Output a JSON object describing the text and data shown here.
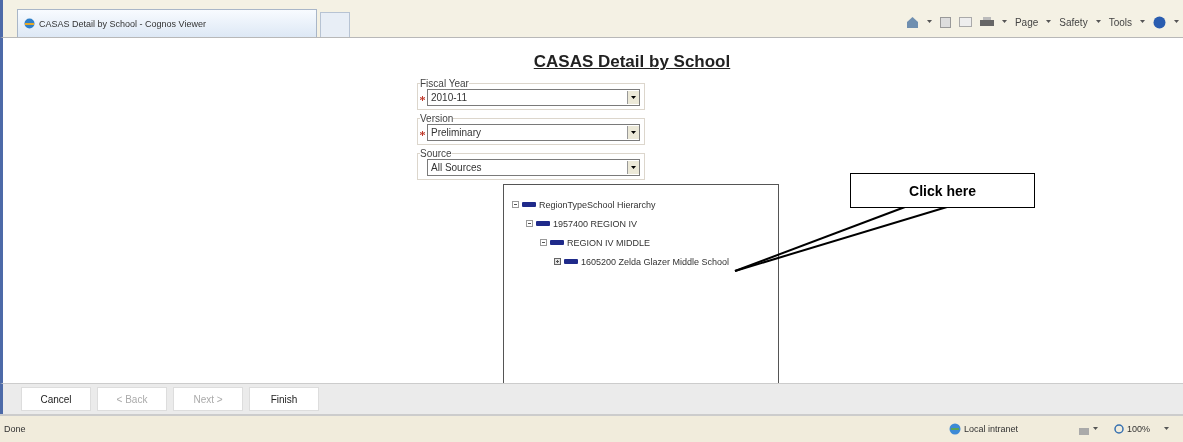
{
  "browser_tab": {
    "title": "CASAS Detail by School - Cognos Viewer"
  },
  "toolbar": {
    "menus": [
      "Page",
      "Safety",
      "Tools"
    ]
  },
  "report": {
    "title": "CASAS Detail by School"
  },
  "parameters": [
    {
      "label": "Fiscal Year",
      "value": "2010-11",
      "required": true
    },
    {
      "label": "Version",
      "value": "Preliminary",
      "required": true
    },
    {
      "label": "Source",
      "value": "All Sources",
      "required": false
    }
  ],
  "tree": [
    {
      "label": "RegionTypeSchool Hierarchy",
      "expanded": true,
      "children": [
        {
          "label": "1957400 REGION IV",
          "expanded": true,
          "children": [
            {
              "label": "REGION IV MIDDLE",
              "expanded": true,
              "children": [
                {
                  "label": "1605200 Zelda Glazer Middle School",
                  "expanded": false
                }
              ]
            }
          ]
        }
      ]
    }
  ],
  "callout": {
    "text": "Click here"
  },
  "buttons": [
    {
      "label": "Cancel",
      "disabled": false
    },
    {
      "label": "< Back",
      "disabled": true
    },
    {
      "label": "Next >",
      "disabled": true
    },
    {
      "label": "Finish",
      "disabled": false
    }
  ],
  "status_bar": {
    "text": "Done",
    "zone": "Local intranet",
    "zoom": "100%"
  }
}
